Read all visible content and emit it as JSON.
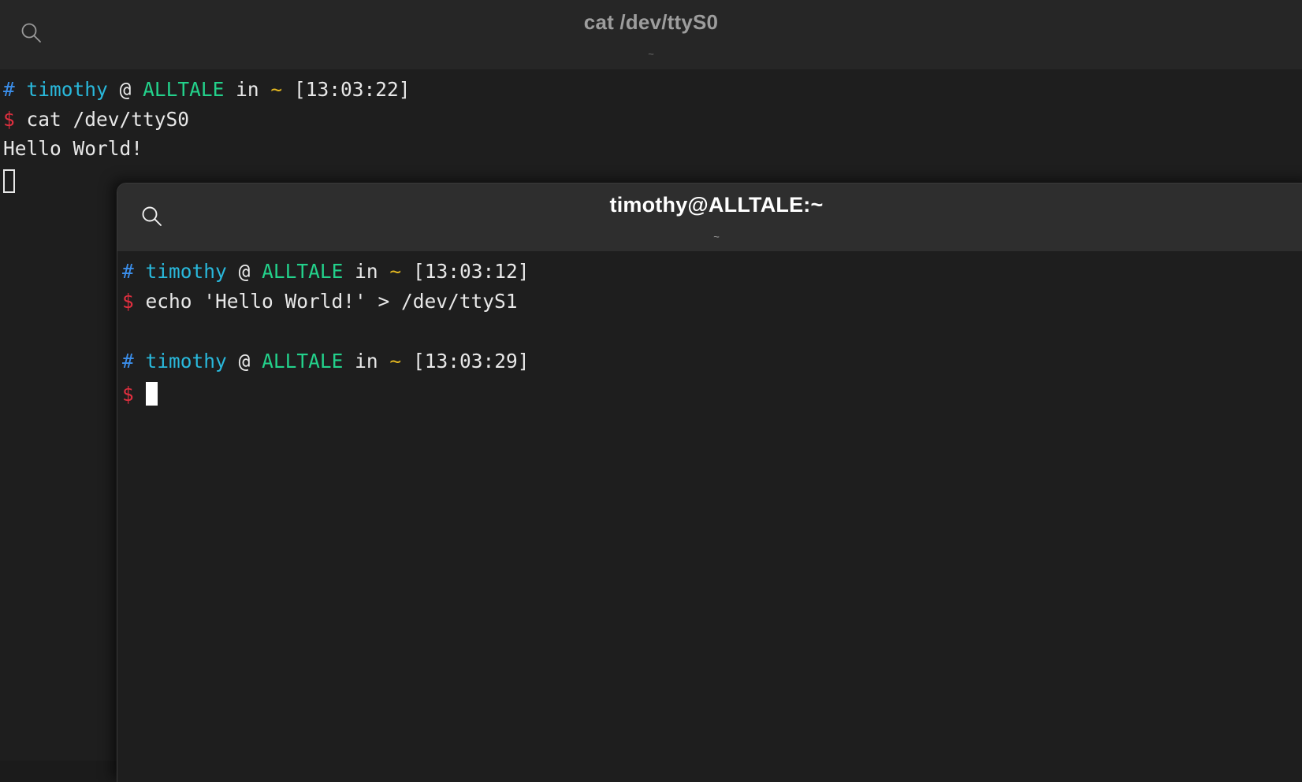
{
  "back_window": {
    "title": "cat /dev/ttyS0",
    "subtitle": "~",
    "search_icon": "search-icon",
    "focused": false,
    "lines": [
      {
        "type": "prompt",
        "hash": "#",
        "user": "timothy",
        "at": "@",
        "host": "ALLTALE",
        "in": "in",
        "path": "~",
        "time": "[13:03:22]"
      },
      {
        "type": "command",
        "sigil": "$",
        "text": "cat /dev/ttyS0"
      },
      {
        "type": "output",
        "text": "Hello World!"
      },
      {
        "type": "cursor",
        "style": "hollow"
      }
    ]
  },
  "front_window": {
    "title": "timothy@ALLTALE:~",
    "subtitle": "~",
    "search_icon": "search-icon",
    "focused": true,
    "lines": [
      {
        "type": "prompt",
        "hash": "#",
        "user": "timothy",
        "at": "@",
        "host": "ALLTALE",
        "in": "in",
        "path": "~",
        "time": "[13:03:12]"
      },
      {
        "type": "command",
        "sigil": "$",
        "text": "echo 'Hello World!' > /dev/ttyS1"
      },
      {
        "type": "blank",
        "text": ""
      },
      {
        "type": "prompt",
        "hash": "#",
        "user": "timothy",
        "at": "@",
        "host": "ALLTALE",
        "in": "in",
        "path": "~",
        "time": "[13:03:29]"
      },
      {
        "type": "command_cursor",
        "sigil": "$",
        "text": "",
        "style": "solid"
      }
    ]
  },
  "colors": {
    "window_bg": "#1e1e1e",
    "titlebar_unfocused": "#262626",
    "titlebar_focused": "#2e2e2e",
    "prompt_hash": "#3b8eea",
    "prompt_user": "#29b8db",
    "prompt_host": "#23d18b",
    "prompt_path": "#e5b820",
    "prompt_sigil": "#e02f3f",
    "text": "#e8e8e8"
  }
}
